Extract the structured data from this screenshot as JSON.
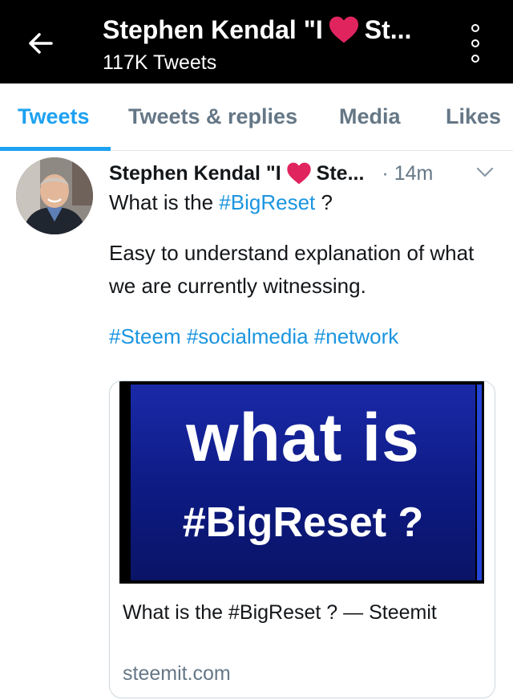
{
  "header": {
    "title_before": "Stephen Kendal \"I",
    "title_after": "St...",
    "subtitle": "117K Tweets"
  },
  "tabs": [
    {
      "label": "Tweets",
      "active": true
    },
    {
      "label": "Tweets & replies",
      "active": false
    },
    {
      "label": "Media",
      "active": false
    },
    {
      "label": "Likes",
      "active": false
    }
  ],
  "tweet": {
    "name_before": "Stephen Kendal \"I",
    "name_after": "Ste...",
    "time": "· 14m",
    "text_line1_prefix": "What is the",
    "text_line1_hashtag": "#BigReset",
    "text_line1_suffix": " ?",
    "text_para2": "Easy to understand explanation of what we are currently witnessing.",
    "hashtags": "#Steem #socialmedia #network"
  },
  "card": {
    "image_big_text": "what is",
    "image_small_text": "#BigReset ?",
    "title": "What is the #BigReset ? — Steemit",
    "domain": "steemit.com"
  },
  "colors": {
    "accent": "#1da1f2",
    "heart": "#e0245e",
    "topbar": "#000000"
  },
  "icons": {
    "back": "back-arrow-icon",
    "more": "more-vertical-icon",
    "heart": "heart-icon",
    "caret": "chevron-down-icon"
  }
}
